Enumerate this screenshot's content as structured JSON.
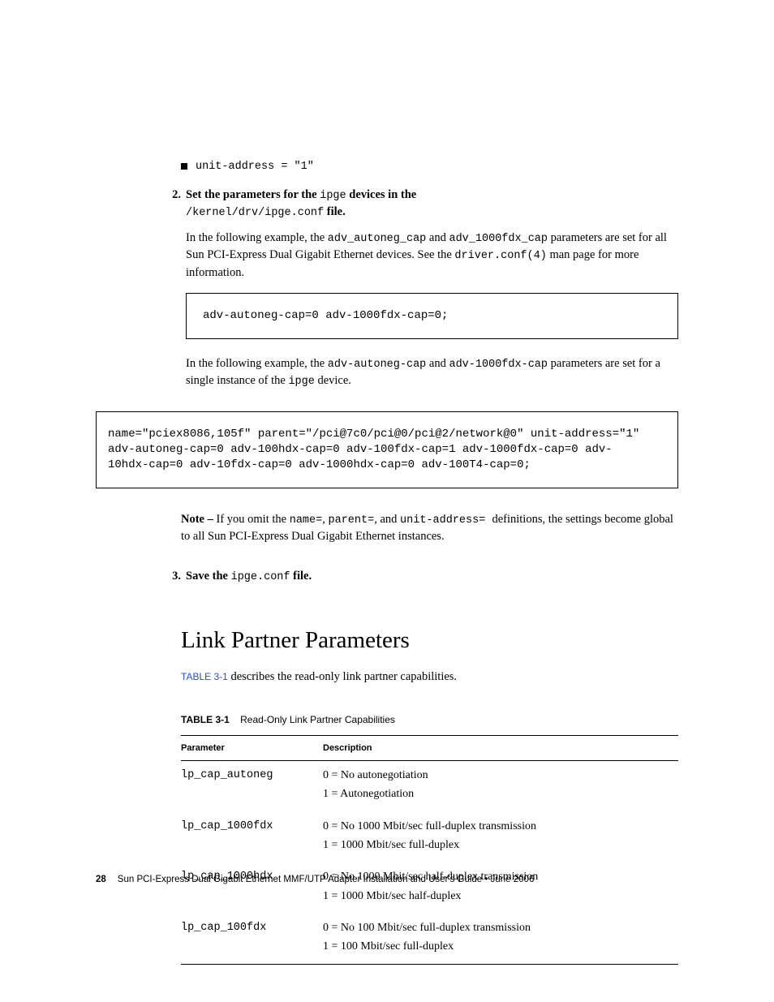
{
  "bullet1": "unit-address = \"1\"",
  "step2": {
    "num": "2.",
    "line1a": "Set the parameters for the ",
    "line1b": "ipge",
    "line1c": " devices in the",
    "line2a": "/kernel/drv/ipge.conf",
    "line2b": " file."
  },
  "para1a": "In the following example, the ",
  "para1b": "adv_autoneg_cap",
  "para1c": " and ",
  "para1d": "adv_1000fdx_cap",
  "para1e": " parameters are set for all Sun PCI-Express Dual Gigabit Ethernet devices. See the ",
  "para1f": "driver.conf(4)",
  "para1g": " man page for more information.",
  "code1": "adv-autoneg-cap=0 adv-1000fdx-cap=0;",
  "para2a": "In the following example, the ",
  "para2b": "adv-autoneg-cap",
  "para2c": " and ",
  "para2d": "adv-1000fdx-cap",
  "para2e": " parameters are set for a single instance of the ",
  "para2f": "ipge",
  "para2g": " device.",
  "code2": "name=\"pciex8086,105f\" parent=\"/pci@7c0/pci@0/pci@2/network@0\" unit-address=\"1\"\nadv-autoneg-cap=0 adv-100hdx-cap=0 adv-100fdx-cap=1 adv-1000fdx-cap=0 adv-\n10hdx-cap=0 adv-10fdx-cap=0 adv-1000hdx-cap=0 adv-100T4-cap=0;",
  "noteLead": "Note – ",
  "noteA": "If you omit the ",
  "noteB": "name=",
  "noteC": ", ",
  "noteD": "parent=",
  "noteE": ", and ",
  "noteF": "unit-address= ",
  "noteG": " definitions, the settings become global to all Sun PCI-Express Dual Gigabit Ethernet instances.",
  "step3": {
    "num": "3.",
    "a": "Save the ",
    "b": "ipge.conf",
    "c": " file."
  },
  "heading": "Link Partner Parameters",
  "introA": "TABLE 3-1",
  "introB": " describes the read-only link partner capabilities.",
  "captionA": "TABLE 3-1",
  "captionB": "Read-Only Link Partner Capabilities",
  "th1": "Parameter",
  "th2": "Description",
  "rows": [
    {
      "p": "lp_cap_autoneg",
      "d0": "0 = No autonegotiation",
      "d1": "1 = Autonegotiation"
    },
    {
      "p": "lp_cap_1000fdx",
      "d0": "0 = No 1000 Mbit/sec full-duplex transmission",
      "d1": "1 = 1000 Mbit/sec full-duplex"
    },
    {
      "p": "lp_cap_1000hdx",
      "d0": "0 = No 1000 Mbit/sec half-duplex transmission",
      "d1": "1 = 1000 Mbit/sec half-duplex"
    },
    {
      "p": "lp_cap_100fdx",
      "d0": "0 = No 100 Mbit/sec full-duplex transmission",
      "d1": "1 = 100 Mbit/sec full-duplex"
    }
  ],
  "footerPage": "28",
  "footerText": "Sun PCI-Express Dual Gigabit Ethernet MMF/UTP Adapter Installation and User's Guide  •  June 2006"
}
